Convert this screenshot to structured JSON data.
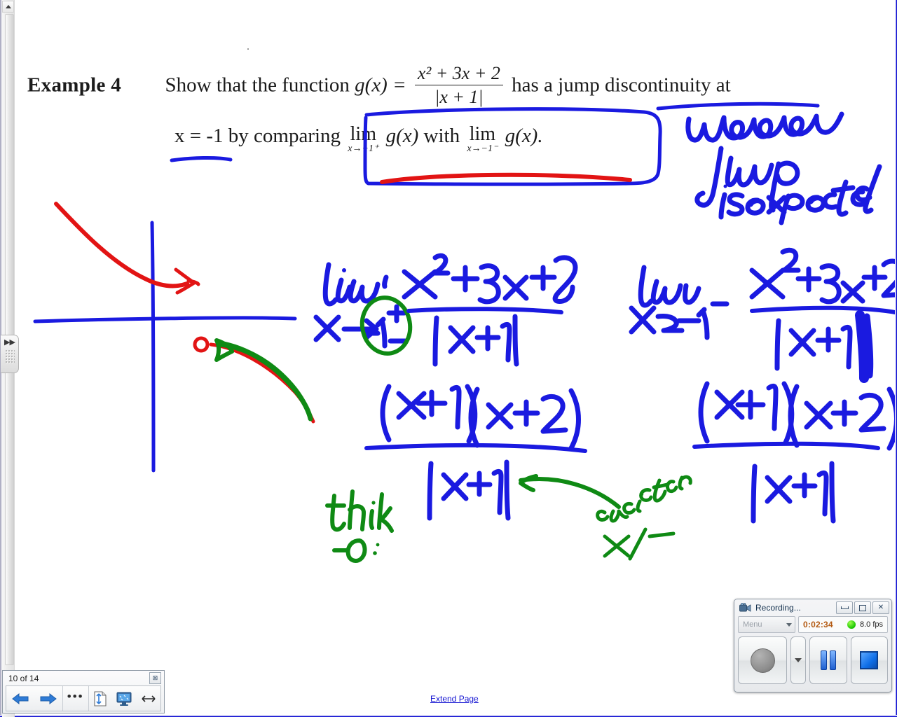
{
  "window": {
    "board_background": "#ffffff",
    "border_accent": "#1414d2"
  },
  "scrollbar": {
    "up_arrow_name": "scroll-up-arrow"
  },
  "flyout": {
    "chevrons": "▶▶"
  },
  "problem": {
    "example_label": "Example 4",
    "sentence_part1": "Show that the function",
    "function_name": "g(x) =",
    "numerator": "x² + 3x + 2",
    "denominator": "|x + 1|",
    "sentence_part2": "has a jump discontinuity at",
    "sentence_part3": "x = -1 by comparing",
    "limit1_word": "lim",
    "limit1_sub": "x→−1⁺",
    "limit1_func": "g(x)",
    "with_word": "with",
    "limit2_word": "lim",
    "limit2_sub": "x→−1⁻",
    "limit2_func": "g(x)."
  },
  "annotations": {
    "blue_note_line1": "whenever",
    "blue_note_line2": "jump",
    "blue_note_line3": "is expected",
    "work_left": {
      "lim": "lim",
      "approach": "x→ -1±",
      "numerator": "x²+3x+2",
      "denominator": "|x+1|",
      "factored_numerator": "(x+1)(x+2)",
      "factored_denominator": "|x+1|"
    },
    "work_right": {
      "lim": "lim",
      "approach": "x→-1⁻",
      "numerator": "x²+3x+2",
      "denominator": "|x+1|",
      "factored_numerator": "(x+1)(x+2)",
      "factored_denominator": "|x+1|"
    },
    "green_notes": {
      "think": "think",
      "think_value": "-0.·",
      "consider": "consider",
      "consider_value": "x/-"
    },
    "ink_colors": {
      "blue": "#1a1ae0",
      "red": "#e21414",
      "green": "#0f8a14"
    }
  },
  "recording_toolbar": {
    "title": "Recording...",
    "camera_icon": "video-camera-icon",
    "minimize_label": "–",
    "restore_label": "❐",
    "close_label": "✕",
    "menu_label": "Menu",
    "timer": "0:02:34",
    "fps": "8.0 fps",
    "status_color": "#16c400",
    "record_button_name": "record-button",
    "pause_button_name": "pause-button",
    "stop_button_name": "stop-button"
  },
  "page_nav": {
    "page_indicator": "10 of 14",
    "close_label": "⊠",
    "prev_label": "previous-page",
    "next_label": "next-page",
    "more_label": "•••",
    "fit_height_label": "fit-page-height",
    "screen_label": "screen-view",
    "fit_width_label": "↔"
  },
  "footer": {
    "extend_page_link": "Extend Page"
  }
}
